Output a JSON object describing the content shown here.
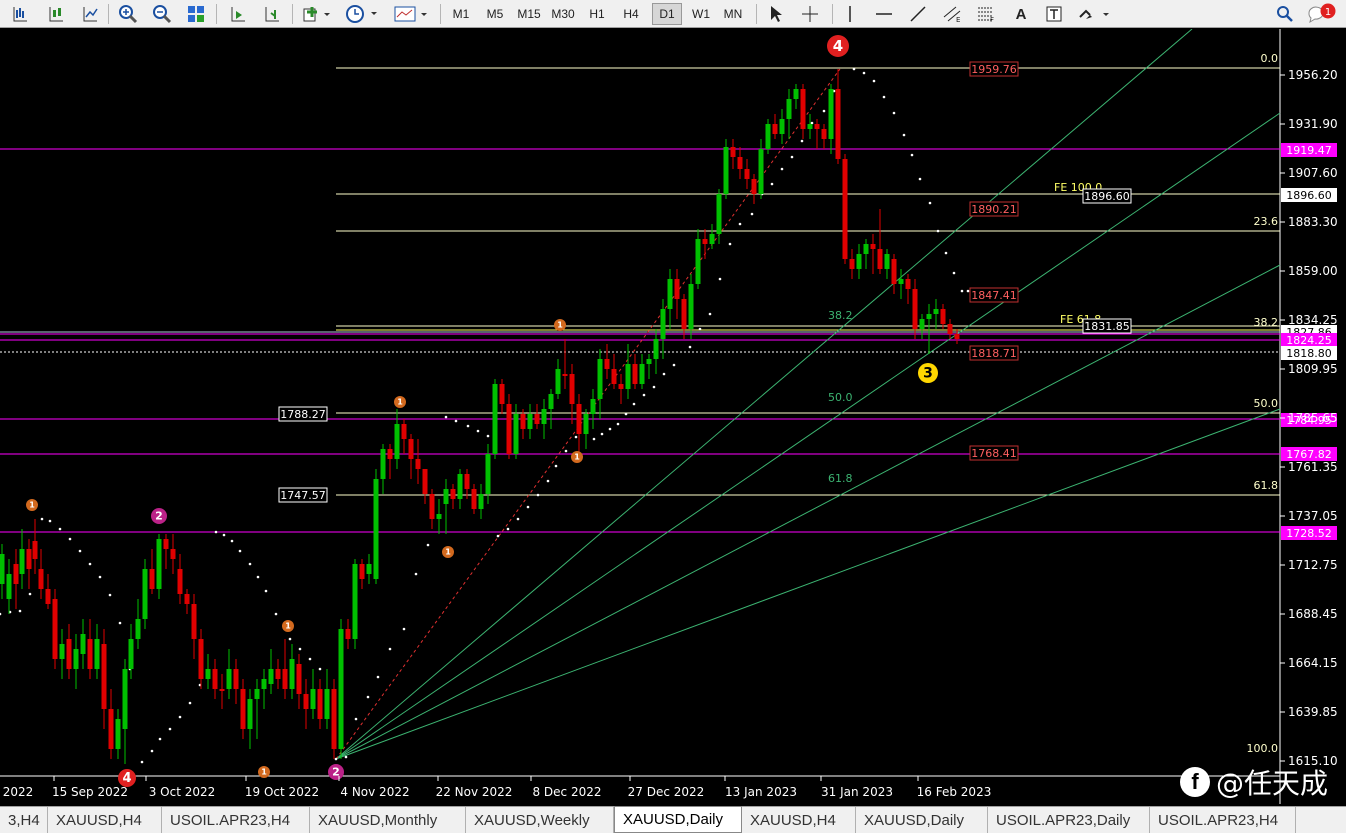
{
  "toolbar": {
    "timeframes": [
      "M1",
      "M5",
      "M15",
      "M30",
      "H1",
      "H4",
      "D1",
      "W1",
      "MN"
    ],
    "active_timeframe": "D1",
    "text_tool_label": "A",
    "notification_count": "1"
  },
  "tabs": [
    "3,H4",
    "XAUUSD,H4",
    "USOIL.APR23,H4",
    "XAUUSD,Monthly",
    "XAUUSD,Weekly",
    "XAUUSD,Daily",
    "XAUUSD,H4",
    "XAUUSD,Daily",
    "USOIL.APR23,Daily",
    "USOIL.APR23,H4"
  ],
  "active_tab_index": 5,
  "watermark": "@任天成",
  "chart_data": {
    "type": "candlestick",
    "symbol": "XAUUSD",
    "timeframe": "Daily",
    "y_ticks": [
      "1956.20",
      "1931.90",
      "1907.60",
      "1883.30",
      "1859.00",
      "1834.25",
      "1809.95",
      "1785.65",
      "1761.35",
      "1737.05",
      "1712.75",
      "1688.45",
      "1664.15",
      "1639.85",
      "1615.10"
    ],
    "y_range": [
      1610,
      1985
    ],
    "x_ticks": [
      "2022",
      "15 Sep 2022",
      "3 Oct 2022",
      "19 Oct 2022",
      "4 Nov 2022",
      "22 Nov 2022",
      "8 Dec 2022",
      "27 Dec 2022",
      "13 Jan 2023",
      "31 Jan 2023",
      "16 Feb 2023"
    ],
    "price_labels": [
      {
        "value": "1919.47",
        "color": "#ff00ff"
      },
      {
        "value": "1896.60",
        "color": "#ffffff"
      },
      {
        "value": "1827.86",
        "color": "#ffffff"
      },
      {
        "value": "1824.25",
        "color": "#ff00ff"
      },
      {
        "value": "1818.80",
        "color": "#ffffff"
      },
      {
        "value": "1784.95",
        "color": "#ff00ff"
      },
      {
        "value": "1767.82",
        "color": "#ff00ff"
      },
      {
        "value": "1728.52",
        "color": "#ff00ff"
      }
    ],
    "fib_retracement_labels": [
      "0.0",
      "23.6",
      "38.2",
      "50.0",
      "61.8",
      "100.0"
    ],
    "fib_fan_labels": [
      "38.2",
      "50.0",
      "61.8"
    ],
    "fib_expansion_labels": [
      "FE 100.0",
      "FE 61.8"
    ],
    "boxed_prices": [
      "1896.60",
      "1831.85",
      "1788.27",
      "1747.57"
    ],
    "red_boxed_prices": [
      "1959.76",
      "1890.21",
      "1847.41",
      "1818.71",
      "1768.41"
    ],
    "wave_labels": [
      {
        "text": "4",
        "color": "#ff0000"
      },
      {
        "text": "3",
        "color": "#ffff00"
      },
      {
        "text": "2",
        "color": "#cc2299"
      },
      {
        "text": "1",
        "color": "#d2691e"
      }
    ],
    "colors": {
      "bull": "#00c000",
      "bear": "#e00000",
      "fib": "#ffffcc",
      "fan": "#3cb371",
      "magenta": "#ff00ff"
    }
  }
}
